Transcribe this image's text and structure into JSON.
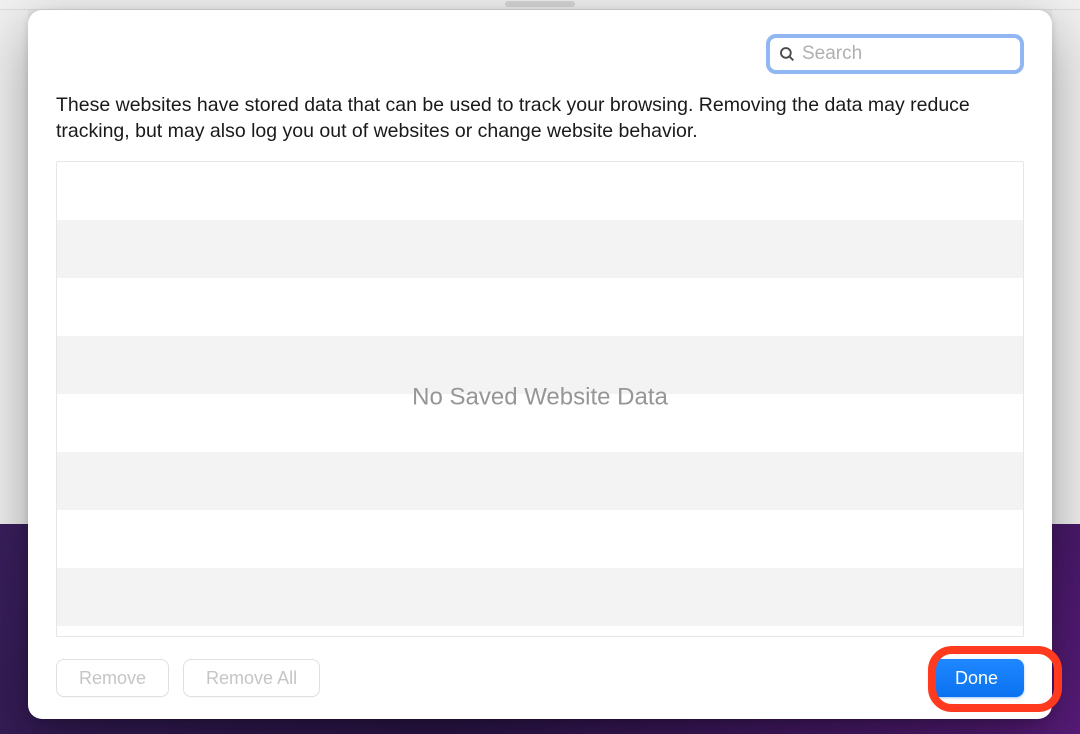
{
  "search": {
    "placeholder": "Search"
  },
  "description": "These websites have stored data that can be used to track your browsing. Removing the data may reduce tracking, but may also log you out of websites or change website behavior.",
  "list": {
    "empty_label": "No Saved Website Data"
  },
  "buttons": {
    "remove": "Remove",
    "remove_all": "Remove All",
    "done": "Done"
  }
}
